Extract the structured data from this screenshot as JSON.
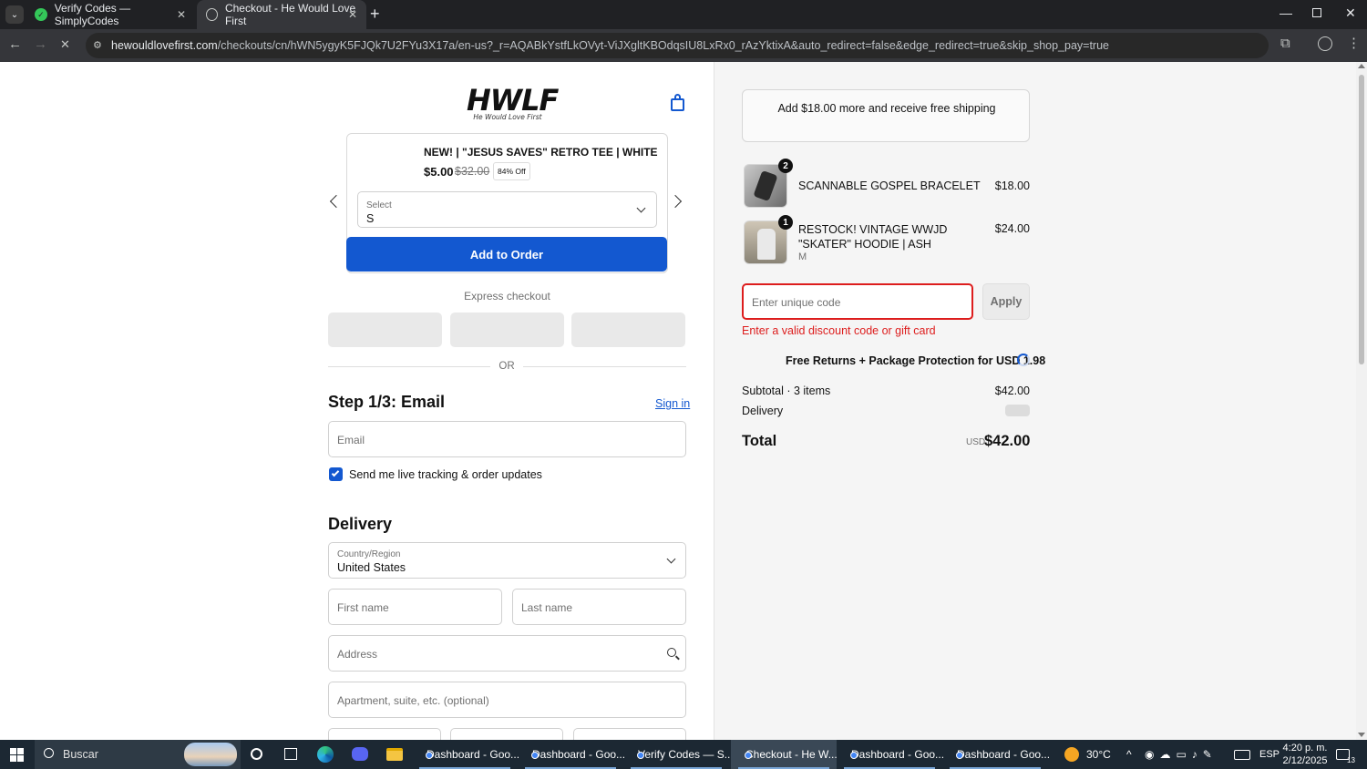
{
  "browser": {
    "tabs": [
      {
        "title": "Verify Codes — SimplyCodes",
        "active": false
      },
      {
        "title": "Checkout - He Would Love First",
        "active": true
      }
    ],
    "url_host": "hewouldlovefirst.com",
    "url_path": "/checkouts/cn/hWN5ygyK5FJQk7U2FYu3X17a/en-us?_r=AQABkYstfLkOVyt-ViJXgltKBOdqsIU8LxRx0_rAzYktixA&auto_redirect=false&edge_redirect=true&skip_shop_pay=true"
  },
  "store": {
    "logo_text": "HWLF",
    "logo_tagline": "He Would Love First"
  },
  "upsell": {
    "product_name": "NEW! | \"JESUS SAVES\" RETRO TEE | WHITE",
    "price": "$5.00",
    "compare_price": "$32.00",
    "discount_badge": "84% Off",
    "size_label": "Select",
    "size_value": "S",
    "add_button": "Add to Order"
  },
  "express": {
    "label": "Express checkout",
    "divider": "OR"
  },
  "email_step": {
    "title": "Step 1/3: Email",
    "sign_in": "Sign in",
    "email_placeholder": "Email",
    "marketing_optin": "Send me live tracking & order updates",
    "marketing_checked": true
  },
  "delivery": {
    "title": "Delivery",
    "country_label": "Country/Region",
    "country_value": "United States",
    "first_name_placeholder": "First name",
    "last_name_placeholder": "Last name",
    "address_placeholder": "Address",
    "apartment_placeholder": "Apartment, suite, etc. (optional)"
  },
  "summary": {
    "shipping_banner": "Add $18.00 more and receive free shipping",
    "items": [
      {
        "name": "SCANNABLE GOSPEL BRACELET",
        "variant": "",
        "quantity": "2",
        "price": "$18.00"
      },
      {
        "name": "RESTOCK! VINTAGE WWJD \"SKATER\" HOODIE | ASH",
        "variant": "M",
        "quantity": "1",
        "price": "$24.00"
      }
    ],
    "discount_placeholder": "Enter unique code",
    "apply_button": "Apply",
    "discount_error": "Enter a valid discount code or gift card",
    "protection_text": "Free Returns + Package Protection for USD 1.98",
    "subtotal_label": "Subtotal · 3 items",
    "subtotal_value": "$42.00",
    "delivery_label": "Delivery",
    "total_label": "Total",
    "total_currency": "USD",
    "total_value": "$42.00"
  },
  "taskbar": {
    "search_placeholder": "Buscar",
    "apps": [
      {
        "label": "Dashboard - Goo..."
      },
      {
        "label": "Dashboard - Goo..."
      },
      {
        "label": "Verify Codes — S..."
      },
      {
        "label": "Checkout - He W..."
      },
      {
        "label": "Dashboard - Goo..."
      },
      {
        "label": "Dashboard - Goo..."
      }
    ],
    "weather": "30°C",
    "language": "ESP",
    "time": "4:20 p. m.",
    "date": "2/12/2025",
    "notification_count": "13"
  }
}
